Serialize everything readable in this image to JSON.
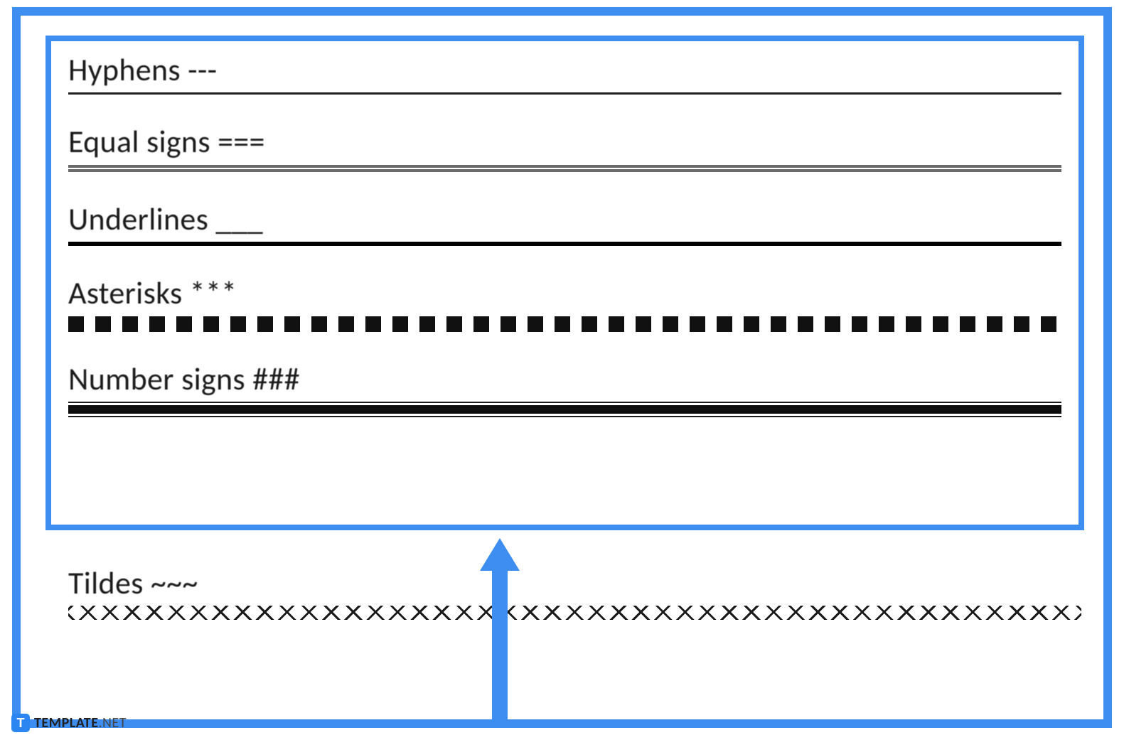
{
  "items": [
    {
      "label": "Hyphens ---",
      "rule_type": "hyphens"
    },
    {
      "label": "Equal signs ===",
      "rule_type": "equals"
    },
    {
      "label": "Underlines ___",
      "rule_type": "underlines"
    },
    {
      "label": "Asterisks ***",
      "rule_type": "asterisks"
    },
    {
      "label": "Number signs ###",
      "rule_type": "numbers"
    },
    {
      "label": "Tildes ~~~",
      "rule_type": "tildes"
    }
  ],
  "watermark": {
    "icon_letter": "T",
    "text_bold": "TEMPLATE",
    "text_thin": ".NET"
  }
}
